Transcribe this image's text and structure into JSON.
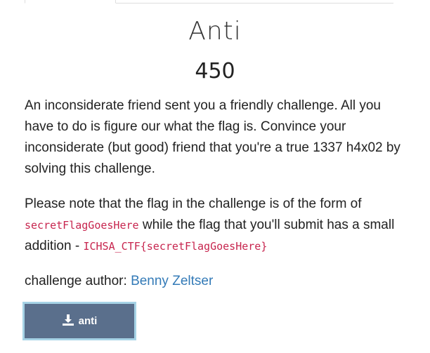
{
  "challenge": {
    "name": "Anti",
    "points": "450"
  },
  "description": {
    "p1": "An inconsiderate friend sent you a friendly challenge. All you have to do is figure our what the flag is. Convince your inconsiderate (but good) friend that you're a true 1337 h4x02 by solving this challenge.",
    "p2_before": "Please note that the flag in the challenge is of the form of",
    "p2_code1": "secretFlagGoesHere",
    "p2_middle": "while the flag that you'll submit has a small addition -",
    "p2_code2": "ICHSA_CTF{secretFlagGoesHere}",
    "author_label": "challenge author:",
    "author_name": "Benny Zeltser"
  },
  "download": {
    "label": "anti",
    "icon": "download-icon"
  },
  "colors": {
    "button_bg": "#5a6f8c",
    "button_border": "#a6d3e6",
    "code": "#c7254e",
    "link": "#337ab7"
  }
}
